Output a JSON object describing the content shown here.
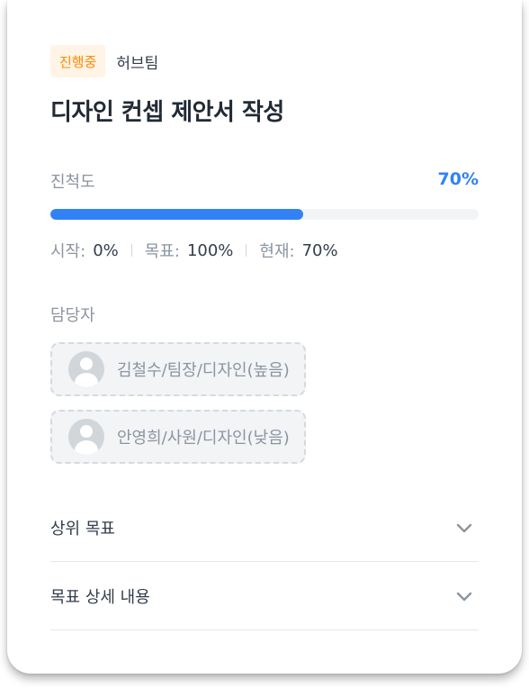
{
  "card": {
    "status_badge": "진행중",
    "team": "허브팀",
    "title": "디자인 컨셉 제안서 작성"
  },
  "progress": {
    "label": "진척도",
    "value_text": "70%",
    "fraction": 0.59
  },
  "stats": {
    "start_label": "시작:",
    "start_value": "0%",
    "target_label": "목표:",
    "target_value": "100%",
    "current_label": "현재:",
    "current_value": "70%"
  },
  "assignees": {
    "label": "담당자",
    "items": [
      {
        "name": "김철수/팀장/디자인(높음)",
        "icon": "user-avatar-icon"
      },
      {
        "name": "안영희/사원/디자인(낮음)",
        "icon": "user-avatar-icon"
      }
    ]
  },
  "sections": [
    {
      "label": "상위 목표",
      "icon": "chevron-down-icon"
    },
    {
      "label": "목표 상세 내용",
      "icon": "chevron-down-icon"
    }
  ],
  "colors": {
    "accent": "#3182f6",
    "badge_text": "#ff8a00",
    "badge_bg": "#fff4e6",
    "muted": "#8b95a1"
  }
}
